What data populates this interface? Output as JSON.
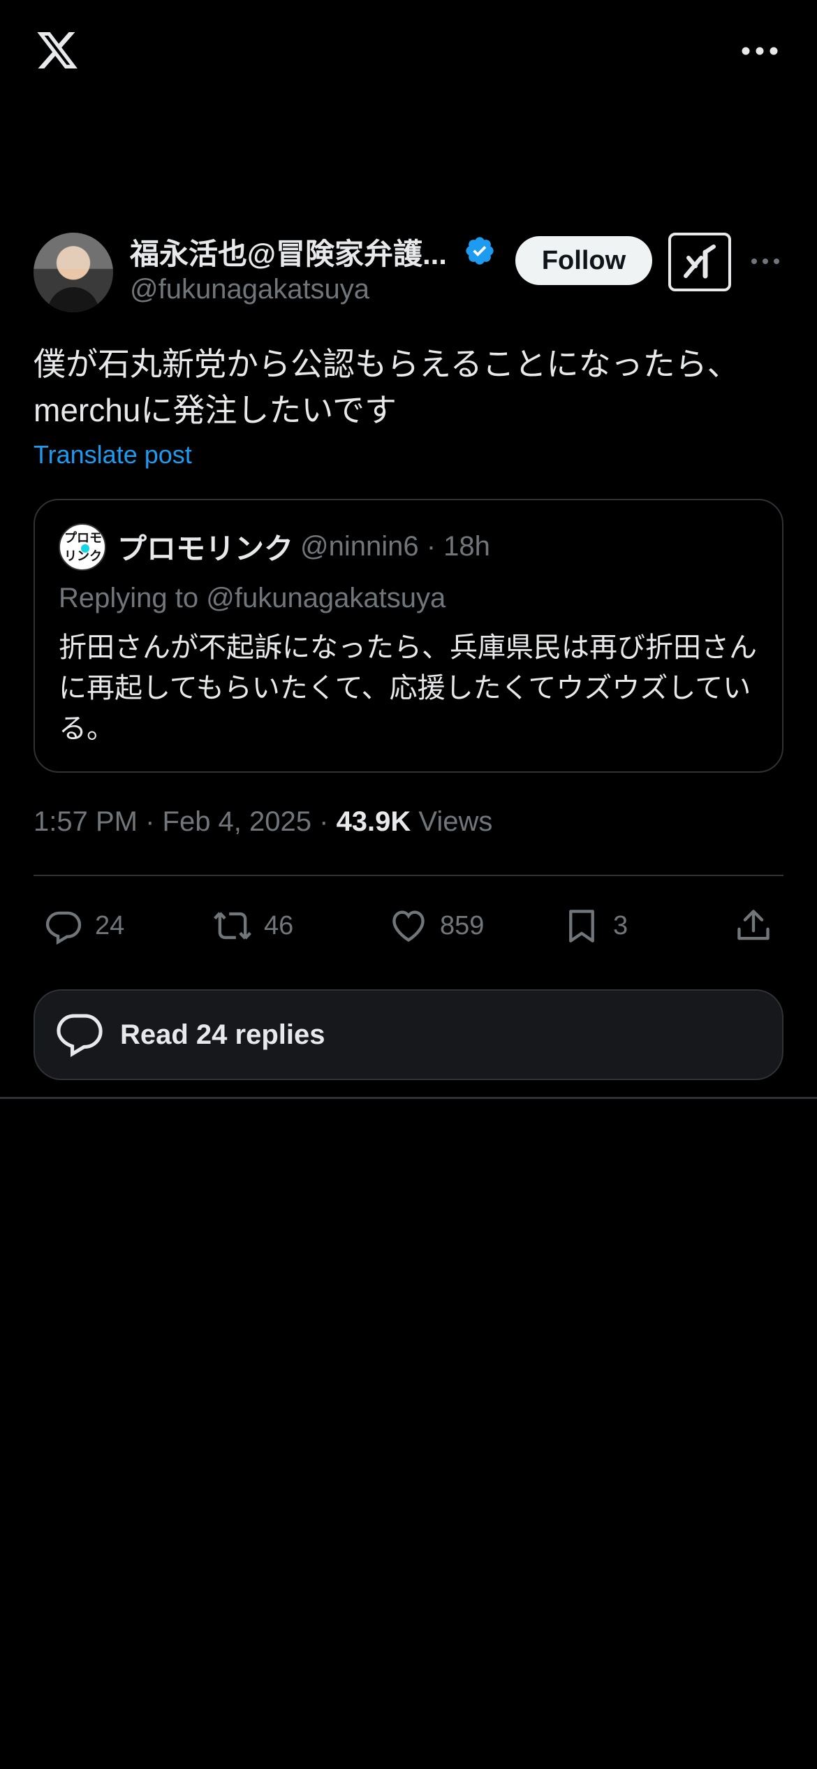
{
  "header": {
    "logo_icon": "x-logo-icon",
    "more_icon": "more-horizontal-icon"
  },
  "post": {
    "author": {
      "display_name": "福永活也@冒険家弁護...",
      "handle": "@fukunagakatsuya",
      "verified_icon": "verified-badge-icon",
      "verified_color": "#1d9bf0"
    },
    "follow_label": "Follow",
    "grok_icon": "grok-icon",
    "text": "僕が石丸新党から公認もらえることになったら、merchuに発注したいです",
    "translate_label": "Translate post",
    "quote": {
      "avatar_text": "プロモリンク",
      "name": "プロモリンク",
      "meta": "@ninnin6 · 18h",
      "replying_to": "Replying to @fukunagakatsuya",
      "text": "折田さんが不起訴になったら、兵庫県民は再び折田さんに再起してもらいたくて、応援したくてウズウズしている。"
    },
    "timestamp": "1:57 PM · Feb 4, 2025 · ",
    "views_count": "43.9K",
    "views_label": " Views",
    "actions": {
      "replies": "24",
      "reposts": "46",
      "likes": "859",
      "bookmarks": "3"
    },
    "read_replies_label": "Read 24 replies"
  },
  "colors": {
    "background": "#000000",
    "text_primary": "#e7e9ea",
    "text_secondary": "#71767b",
    "accent": "#1d9bf0",
    "border": "#2f3336"
  }
}
